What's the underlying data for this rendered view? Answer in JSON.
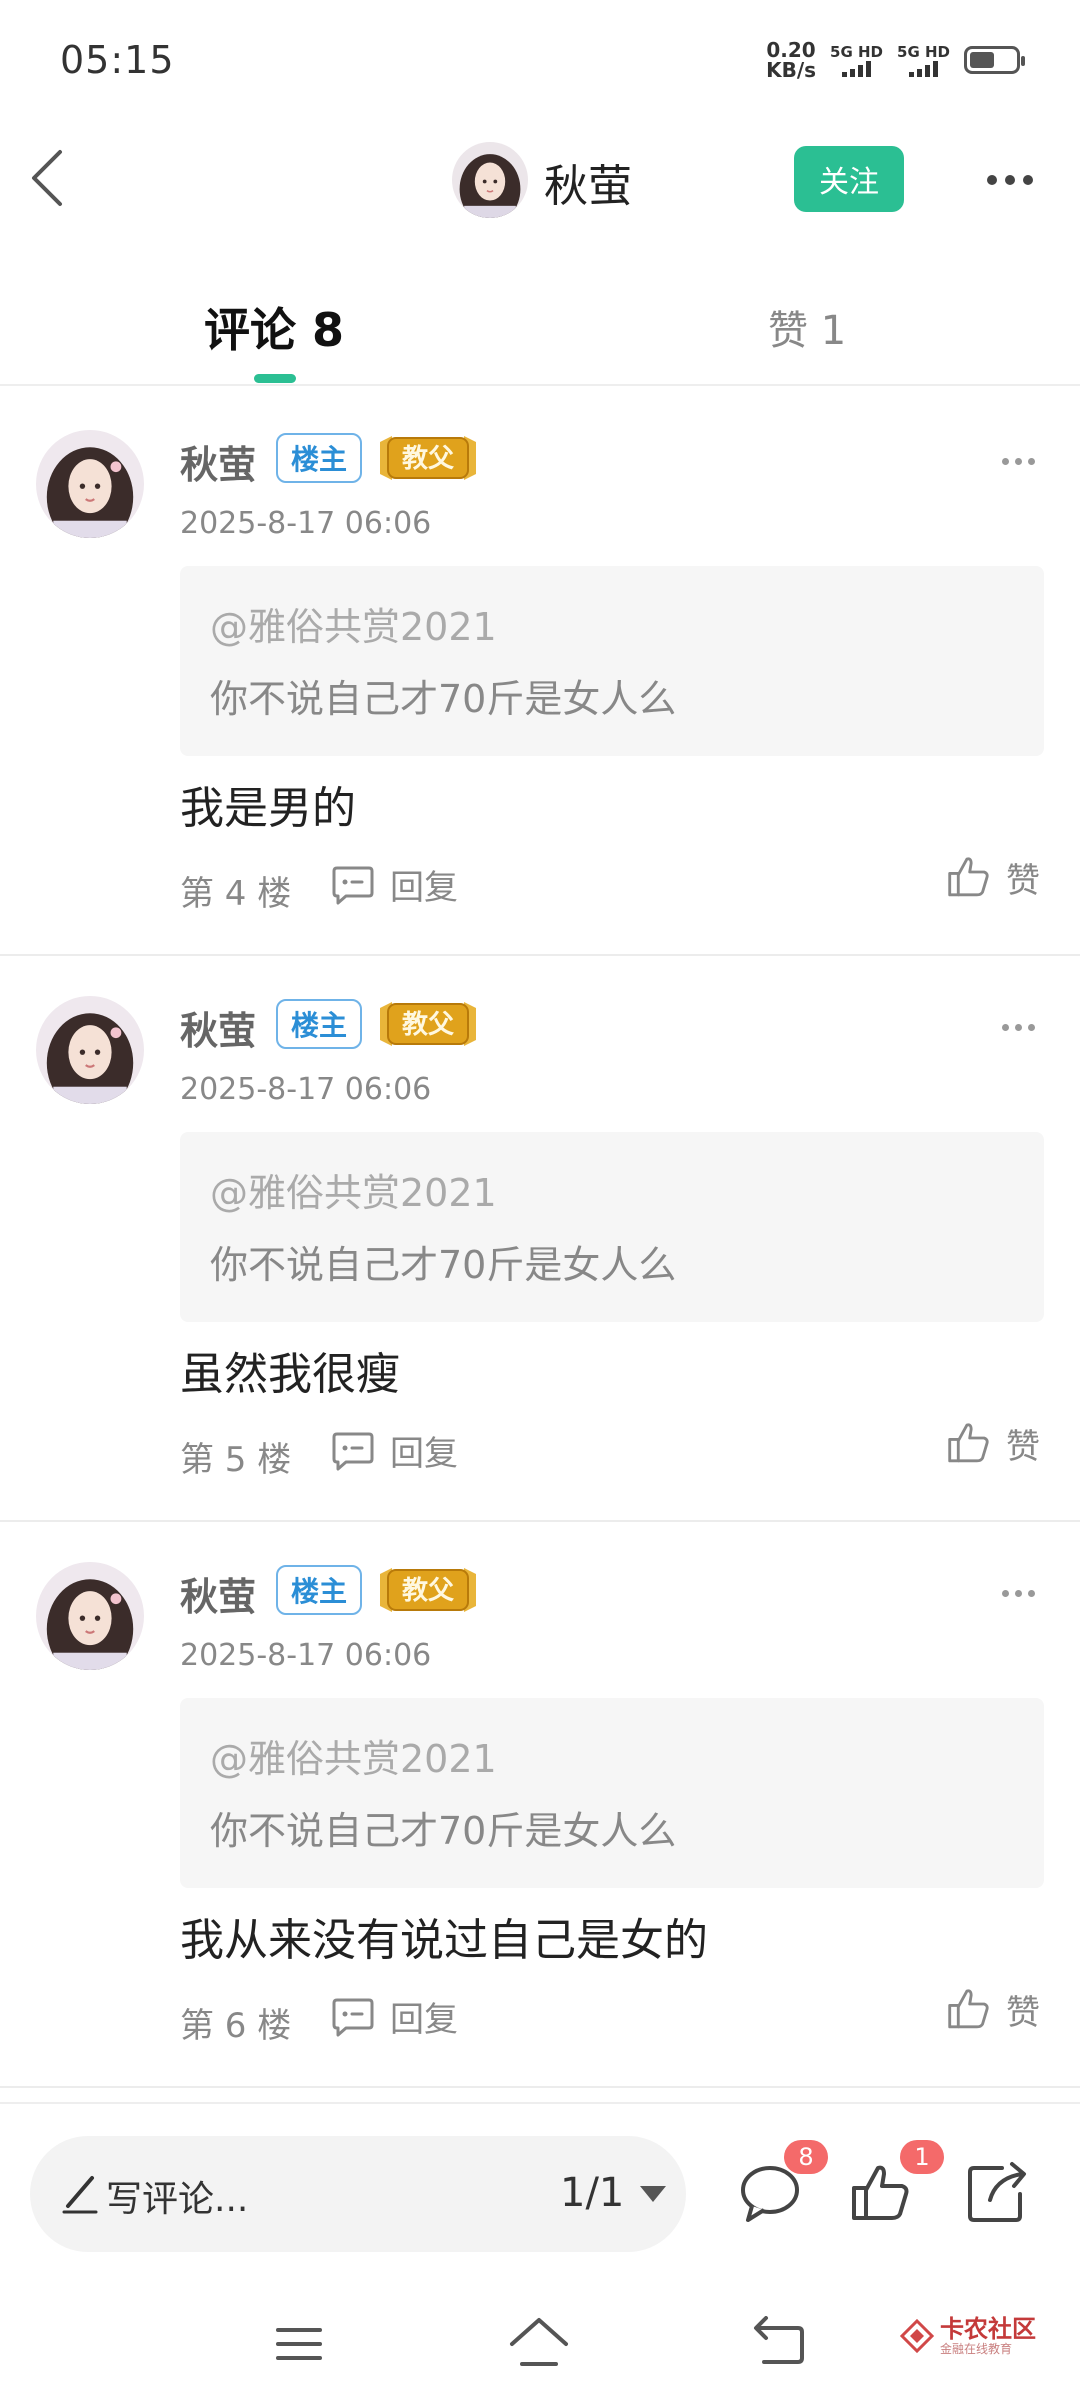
{
  "status": {
    "time": "05:15",
    "net_speed_value": "0.20",
    "net_speed_unit": "KB/s",
    "sim1": "5G HD",
    "sim2": "5G HD",
    "battery_level": 0.45
  },
  "header": {
    "user_name": "秋萤",
    "follow_label": "关注"
  },
  "tabs": [
    {
      "label": "评论 8",
      "active": true
    },
    {
      "label": "赞 1",
      "active": false
    }
  ],
  "comments": [
    {
      "name": "秋萤",
      "host_badge": "楼主",
      "rank_badge": "教父",
      "time": "2025-8-17 06:06",
      "quote_user": "@雅俗共赏2021",
      "quote_text": "你不说自己才70斤是女人么",
      "text": "我是男的",
      "floor": "第 4 楼",
      "reply_label": "回复",
      "like_label": "赞"
    },
    {
      "name": "秋萤",
      "host_badge": "楼主",
      "rank_badge": "教父",
      "time": "2025-8-17 06:06",
      "quote_user": "@雅俗共赏2021",
      "quote_text": "你不说自己才70斤是女人么",
      "text": "虽然我很瘦",
      "floor": "第 5 楼",
      "reply_label": "回复",
      "like_label": "赞"
    },
    {
      "name": "秋萤",
      "host_badge": "楼主",
      "rank_badge": "教父",
      "time": "2025-8-17 06:06",
      "quote_user": "@雅俗共赏2021",
      "quote_text": "你不说自己才70斤是女人么",
      "text": "我从来没有说过自己是女的",
      "floor": "第 6 楼",
      "reply_label": "回复",
      "like_label": "赞"
    }
  ],
  "bottom": {
    "write_placeholder": "写评论...",
    "page_indicator": "1/1",
    "comment_count": "8",
    "like_count": "1"
  },
  "brand": {
    "name": "卡农社区",
    "tagline": "金融在线教育"
  },
  "colors": {
    "accent": "#2bbf93",
    "badge_red": "#f46a6a",
    "host_badge_blue": "#2b8ed6",
    "rank_gold": "#e0a21c"
  },
  "icons": [
    "back-arrow-icon",
    "more-icon",
    "reply-icon",
    "thumbs-up-icon",
    "pencil-icon",
    "caret-down-icon",
    "comment-bubble-icon",
    "share-icon",
    "menu-icon",
    "home-icon",
    "return-icon"
  ]
}
